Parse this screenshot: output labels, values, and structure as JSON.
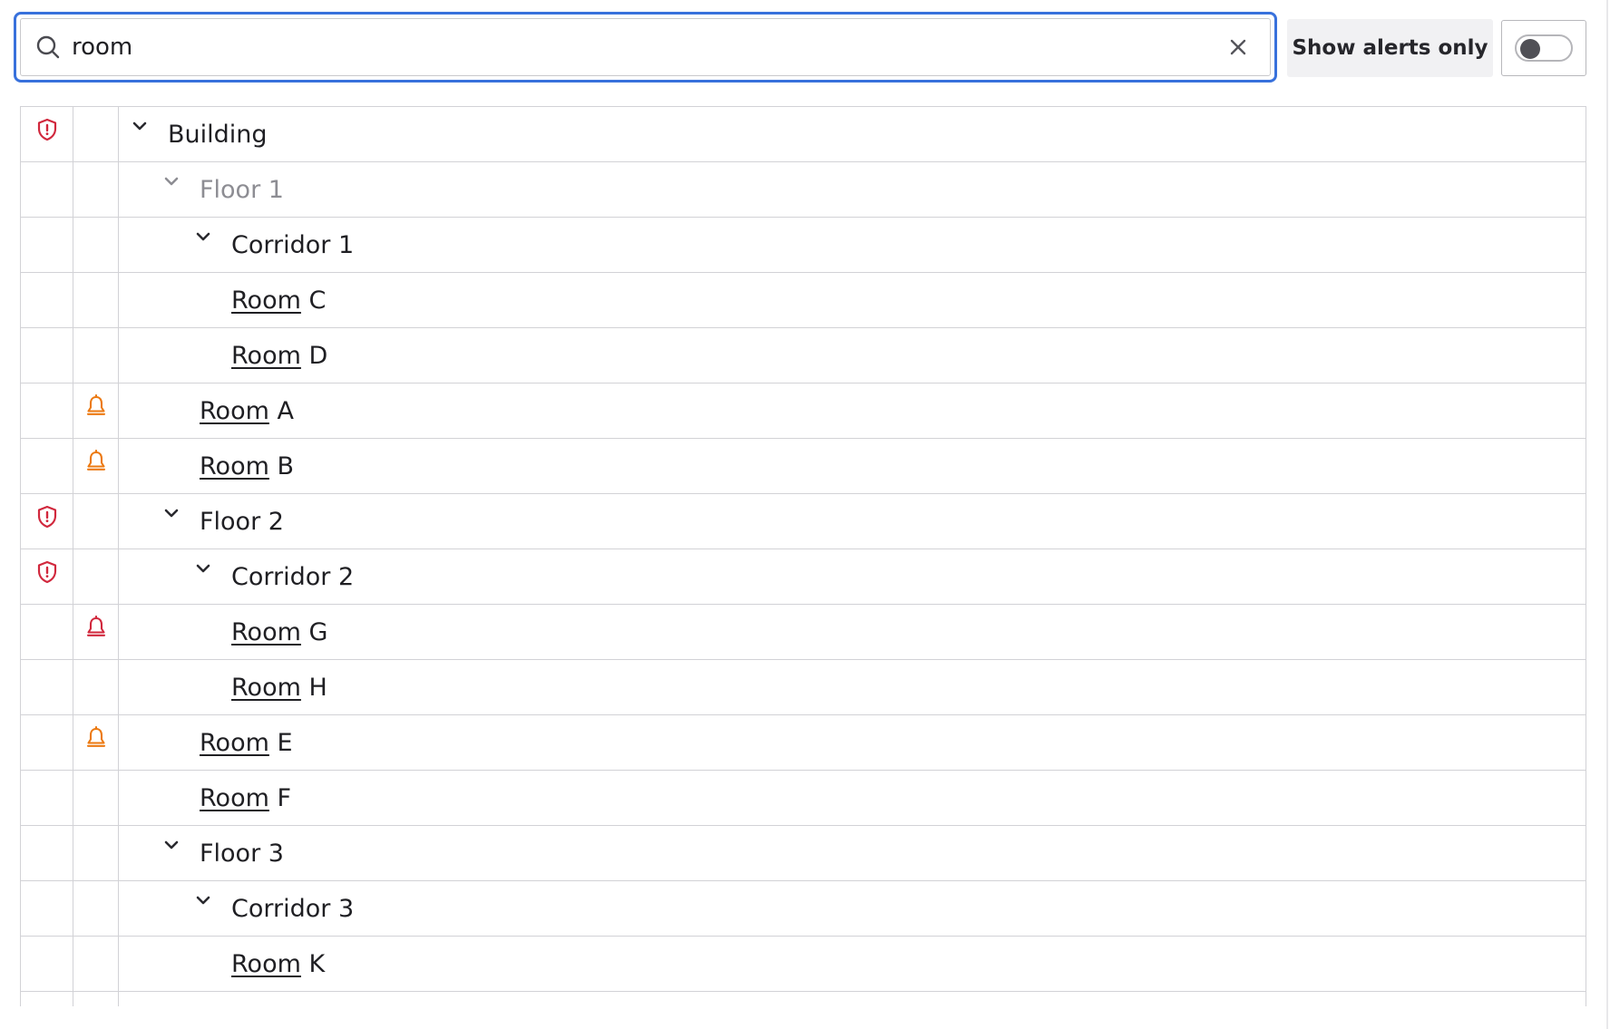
{
  "search": {
    "value": "room",
    "placeholder": ""
  },
  "toggle": {
    "label": "Show alerts only",
    "checked": false
  },
  "colors": {
    "focus_ring": "#3871dc",
    "alert_red": "#d1283d",
    "warning_orange": "#ec7a12",
    "dim_text": "#8d8d93"
  },
  "tree": {
    "rows": [
      {
        "label": "Building",
        "depth": 0,
        "expandable": true,
        "dim": false,
        "alert_icon": "shield-alert-icon",
        "notify_icon": ""
      },
      {
        "label": "Floor 1",
        "depth": 1,
        "expandable": true,
        "dim": true,
        "alert_icon": "",
        "notify_icon": ""
      },
      {
        "label": "Corridor 1",
        "depth": 2,
        "expandable": true,
        "dim": false,
        "alert_icon": "",
        "notify_icon": ""
      },
      {
        "match": "Room",
        "suffix": " C",
        "depth": 2,
        "expandable": false,
        "dim": false,
        "alert_icon": "",
        "notify_icon": ""
      },
      {
        "match": "Room",
        "suffix": " D",
        "depth": 2,
        "expandable": false,
        "dim": false,
        "alert_icon": "",
        "notify_icon": ""
      },
      {
        "match": "Room",
        "suffix": " A",
        "depth": 1,
        "expandable": false,
        "dim": false,
        "alert_icon": "",
        "notify_icon": "bell-warning-icon"
      },
      {
        "match": "Room",
        "suffix": " B",
        "depth": 1,
        "expandable": false,
        "dim": false,
        "alert_icon": "",
        "notify_icon": "bell-warning-icon"
      },
      {
        "label": "Floor 2",
        "depth": 1,
        "expandable": true,
        "dim": false,
        "alert_icon": "shield-alert-icon",
        "notify_icon": ""
      },
      {
        "label": "Corridor 2",
        "depth": 2,
        "expandable": true,
        "dim": false,
        "alert_icon": "shield-alert-icon",
        "notify_icon": ""
      },
      {
        "match": "Room",
        "suffix": " G",
        "depth": 2,
        "expandable": false,
        "dim": false,
        "alert_icon": "",
        "notify_icon": "bell-alert-icon"
      },
      {
        "match": "Room",
        "suffix": " H",
        "depth": 2,
        "expandable": false,
        "dim": false,
        "alert_icon": "",
        "notify_icon": ""
      },
      {
        "match": "Room",
        "suffix": " E",
        "depth": 1,
        "expandable": false,
        "dim": false,
        "alert_icon": "",
        "notify_icon": "bell-warning-icon"
      },
      {
        "match": "Room",
        "suffix": " F",
        "depth": 1,
        "expandable": false,
        "dim": false,
        "alert_icon": "",
        "notify_icon": ""
      },
      {
        "label": "Floor 3",
        "depth": 1,
        "expandable": true,
        "dim": false,
        "alert_icon": "",
        "notify_icon": ""
      },
      {
        "label": "Corridor 3",
        "depth": 2,
        "expandable": true,
        "dim": false,
        "alert_icon": "",
        "notify_icon": ""
      },
      {
        "match": "Room",
        "suffix": " K",
        "depth": 2,
        "expandable": false,
        "dim": false,
        "alert_icon": "",
        "notify_icon": ""
      }
    ]
  }
}
